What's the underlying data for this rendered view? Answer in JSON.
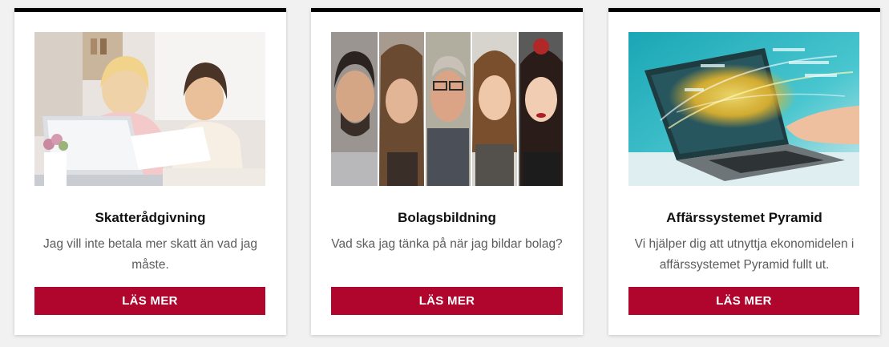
{
  "cards": [
    {
      "title": "Skatterådgivning",
      "description": "Jag vill inte betala mer skatt än vad jag måste.",
      "button_label": "LÄS MER"
    },
    {
      "title": "Bolagsbildning",
      "description": "Vad ska jag tänka på när jag bildar bolag?",
      "button_label": "LÄS MER"
    },
    {
      "title": "Affärssystemet Pyramid",
      "description": "Vi hjälper dig att utnyttja ekonomidelen i affärssystemet Pyramid fullt ut.",
      "button_label": "LÄS MER"
    }
  ],
  "colors": {
    "button_bg": "#b0062e",
    "card_top_border": "#000000",
    "page_bg": "#f1f1f1"
  }
}
